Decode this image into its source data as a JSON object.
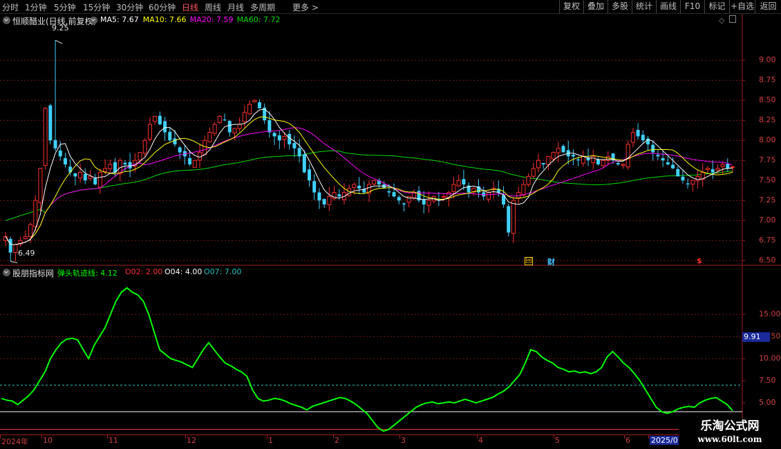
{
  "toolbar": {
    "timeframes": [
      "分时",
      "1分钟",
      "5分钟",
      "15分钟",
      "30分钟",
      "60分钟",
      "日线",
      "周线",
      "月线",
      "多周期"
    ],
    "active_timeframe": "日线",
    "more_label": "更多",
    "more_arrow": ">",
    "buttons": [
      "复权",
      "叠加",
      "多股",
      "统计",
      "画线",
      "F10",
      "标记",
      "+自选",
      "返回"
    ]
  },
  "main_chart": {
    "title": "恒顺醋业(日线,前复权)",
    "ma": [
      {
        "label": "MA5: 7.67",
        "color": "#ffffff"
      },
      {
        "label": "MA10: 7.66",
        "color": "#ffff00"
      },
      {
        "label": "MA20: 7.59",
        "color": "#ff00ff"
      },
      {
        "label": "MA60: 7.72",
        "color": "#00dd00"
      }
    ],
    "high_label": "9.25",
    "low_label": "6.49",
    "yticks": [
      "9.00",
      "8.75",
      "8.50",
      "8.25",
      "8.00",
      "7.75",
      "7.50",
      "7.25",
      "7.00",
      "6.75",
      "6.50"
    ],
    "markers": [
      {
        "text": "回",
        "color": "#ffcc00",
        "icon": "review-marker-icon"
      },
      {
        "text": "财",
        "color": "#40c0ff",
        "icon": "finance-marker-icon"
      },
      {
        "text": "$",
        "color": "#ff3030",
        "icon": "dividend-marker-icon"
      }
    ]
  },
  "indicator": {
    "title": "股朋指标网",
    "lines": [
      {
        "label": "弹头轨迹线: 4.12",
        "color": "#00ff00"
      },
      {
        "label": "O02: 2.00",
        "color": "#ff3030"
      },
      {
        "label": "O04: 4.00",
        "color": "#ffffff"
      },
      {
        "label": "O07: 7.00",
        "color": "#20c0c0"
      }
    ],
    "yticks": [
      "15.00",
      "12.50",
      "10.00",
      "7.50",
      "5.00"
    ],
    "cursor_value": "9.91"
  },
  "xaxis": {
    "labels": [
      "2024年",
      "10",
      "11",
      "12",
      "1",
      "2",
      "3",
      "4",
      "5",
      "6",
      "2025/0"
    ]
  },
  "watermark": {
    "line1": "乐淘公式网",
    "line2": "www.60lt.com"
  },
  "chart_data": [
    {
      "type": "candlestick",
      "title": "恒顺醋业(日线,前复权)",
      "ylim": [
        6.45,
        9.45
      ],
      "yticks": [
        6.5,
        6.75,
        7.0,
        7.25,
        7.5,
        7.75,
        8.0,
        8.25,
        8.5,
        8.75,
        9.0
      ],
      "annotations": {
        "high": 9.25,
        "low": 6.49
      },
      "close_series": [
        6.8,
        6.6,
        6.7,
        6.75,
        6.8,
        6.95,
        7.25,
        7.65,
        8.4,
        8.0,
        7.9,
        7.8,
        7.7,
        7.6,
        7.55,
        7.6,
        7.5,
        7.55,
        7.45,
        7.6,
        7.65,
        7.7,
        7.6,
        7.75,
        7.7,
        7.65,
        7.75,
        7.85,
        8.0,
        8.2,
        8.3,
        8.2,
        8.1,
        8.0,
        7.95,
        7.85,
        7.8,
        7.7,
        7.75,
        7.85,
        8.0,
        8.1,
        8.2,
        8.3,
        8.25,
        8.1,
        8.15,
        8.2,
        8.35,
        8.45,
        8.5,
        8.4,
        8.25,
        8.1,
        8.05,
        8.0,
        8.05,
        7.95,
        7.9,
        7.8,
        7.6,
        7.5,
        7.35,
        7.25,
        7.2,
        7.3,
        7.35,
        7.3,
        7.35,
        7.4,
        7.45,
        7.4,
        7.35,
        7.45,
        7.5,
        7.45,
        7.4,
        7.35,
        7.3,
        7.25,
        7.2,
        7.3,
        7.35,
        7.25,
        7.2,
        7.25,
        7.3,
        7.25,
        7.3,
        7.35,
        7.45,
        7.5,
        7.45,
        7.35,
        7.4,
        7.35,
        7.3,
        7.35,
        7.4,
        7.35,
        7.2,
        6.85,
        7.25,
        7.35,
        7.45,
        7.55,
        7.65,
        7.75,
        7.7,
        7.8,
        7.85,
        7.9,
        7.85,
        7.8,
        7.8,
        7.75,
        7.8,
        7.75,
        7.8,
        7.7,
        7.75,
        7.8,
        7.75,
        7.7,
        7.7,
        7.95,
        8.1,
        8.05,
        8.0,
        7.95,
        7.85,
        7.8,
        7.75,
        7.7,
        7.65,
        7.55,
        7.5,
        7.45,
        7.5,
        7.55,
        7.6,
        7.65,
        7.6,
        7.65,
        7.7,
        7.65,
        7.67
      ],
      "moving_averages": [
        "MA5",
        "MA10",
        "MA20",
        "MA60"
      ],
      "ma_values": {
        "MA5": 7.67,
        "MA10": 7.66,
        "MA20": 7.59,
        "MA60": 7.72
      }
    },
    {
      "type": "line",
      "title": "股朋指标网",
      "ylim": [
        1.5,
        19.3
      ],
      "yticks": [
        5.0,
        7.5,
        10.0,
        12.5,
        15.0
      ],
      "reference_lines": [
        {
          "name": "O02",
          "value": 2.0,
          "color": "#ff3030"
        },
        {
          "name": "O04",
          "value": 4.0,
          "color": "#ffffff"
        },
        {
          "name": "O07",
          "value": 7.0,
          "color": "#20c0c0"
        }
      ],
      "series": [
        {
          "name": "弹头轨迹线",
          "color": "#00ff00",
          "values": [
            5.5,
            5.3,
            5.2,
            4.8,
            5.3,
            5.8,
            6.5,
            7.5,
            8.5,
            10.0,
            11.0,
            11.8,
            12.2,
            12.3,
            12.1,
            11.0,
            10.0,
            11.5,
            12.5,
            13.5,
            15.0,
            16.5,
            17.5,
            18.0,
            17.5,
            17.2,
            16.5,
            15.0,
            13.0,
            11.0,
            10.5,
            10.0,
            9.8,
            9.6,
            9.3,
            9.0,
            10.0,
            11.0,
            11.8,
            11.0,
            10.2,
            9.5,
            9.2,
            8.8,
            8.5,
            8.0,
            6.5,
            5.5,
            5.2,
            5.3,
            5.5,
            5.4,
            5.2,
            4.9,
            4.7,
            4.5,
            4.2,
            4.6,
            4.8,
            5.0,
            5.2,
            5.4,
            5.6,
            5.5,
            5.2,
            4.8,
            4.3,
            3.8,
            3.0,
            2.2,
            1.8,
            2.0,
            2.5,
            3.0,
            3.5,
            4.0,
            4.5,
            4.8,
            5.0,
            5.1,
            4.9,
            5.0,
            5.1,
            5.0,
            5.2,
            5.4,
            5.2,
            5.0,
            5.2,
            5.4,
            5.6,
            6.0,
            6.3,
            6.8,
            7.5,
            8.2,
            9.5,
            11.0,
            10.8,
            10.2,
            9.8,
            9.5,
            9.0,
            8.8,
            8.5,
            8.6,
            8.4,
            8.5,
            8.3,
            8.5,
            9.0,
            10.2,
            10.8,
            10.2,
            9.5,
            9.0,
            8.3,
            7.5,
            6.5,
            5.5,
            4.5,
            4.0,
            3.8,
            4.0,
            4.3,
            4.5,
            4.6,
            4.5,
            5.0,
            5.3,
            5.5,
            5.6,
            5.2,
            4.8,
            4.12
          ]
        }
      ]
    }
  ]
}
